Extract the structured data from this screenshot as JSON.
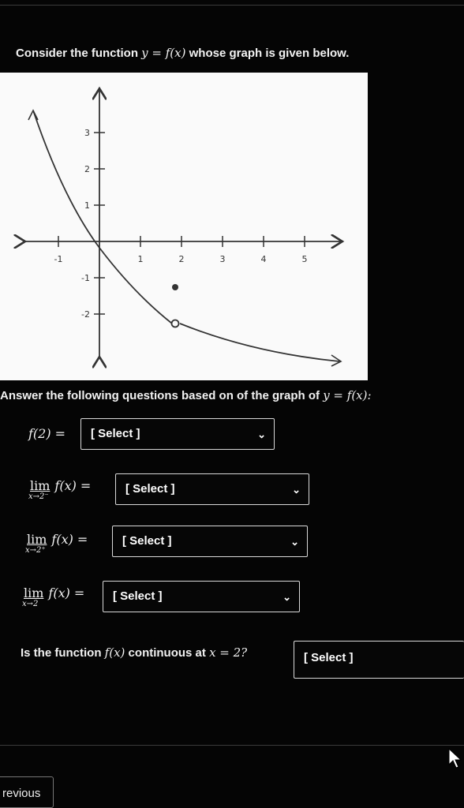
{
  "question": {
    "prompt_pre": "Consider the function ",
    "prompt_math": "y = f(x)",
    "prompt_post": " whose graph is given below."
  },
  "graph": {
    "x_ticks": [
      "-1",
      "1",
      "2",
      "3",
      "4",
      "5"
    ],
    "y_ticks": [
      "3",
      "2",
      "1",
      "-1",
      "-2"
    ],
    "solid_point": [
      2,
      -1
    ],
    "open_point": [
      2,
      -2
    ]
  },
  "answer_intro": {
    "text": "Answer the following questions based on of the graph of ",
    "math": "y = f(x):"
  },
  "questions": [
    {
      "lead": "f(2) =",
      "select": "[ Select ]"
    },
    {
      "lim_word": "lim",
      "lim_sub": "x→2⁻",
      "expr": "f(x) =",
      "select": "[ Select ]"
    },
    {
      "lim_word": "lim",
      "lim_sub": "x→2⁺",
      "expr": "f(x) =",
      "select": "[ Select ]"
    },
    {
      "lim_word": "lim",
      "lim_sub": "x→2",
      "expr": "f(x) =",
      "select": "[ Select ]"
    }
  ],
  "continuity": {
    "pre": "Is the function ",
    "math1": "f(x)",
    "mid": " continuous at ",
    "math2": "x = 2?",
    "select": "[ Select ]"
  },
  "nav": {
    "previous": "revious"
  },
  "icons": {
    "dropdown": "chevron-down-icon",
    "cursor": "pointer-cursor-icon"
  }
}
